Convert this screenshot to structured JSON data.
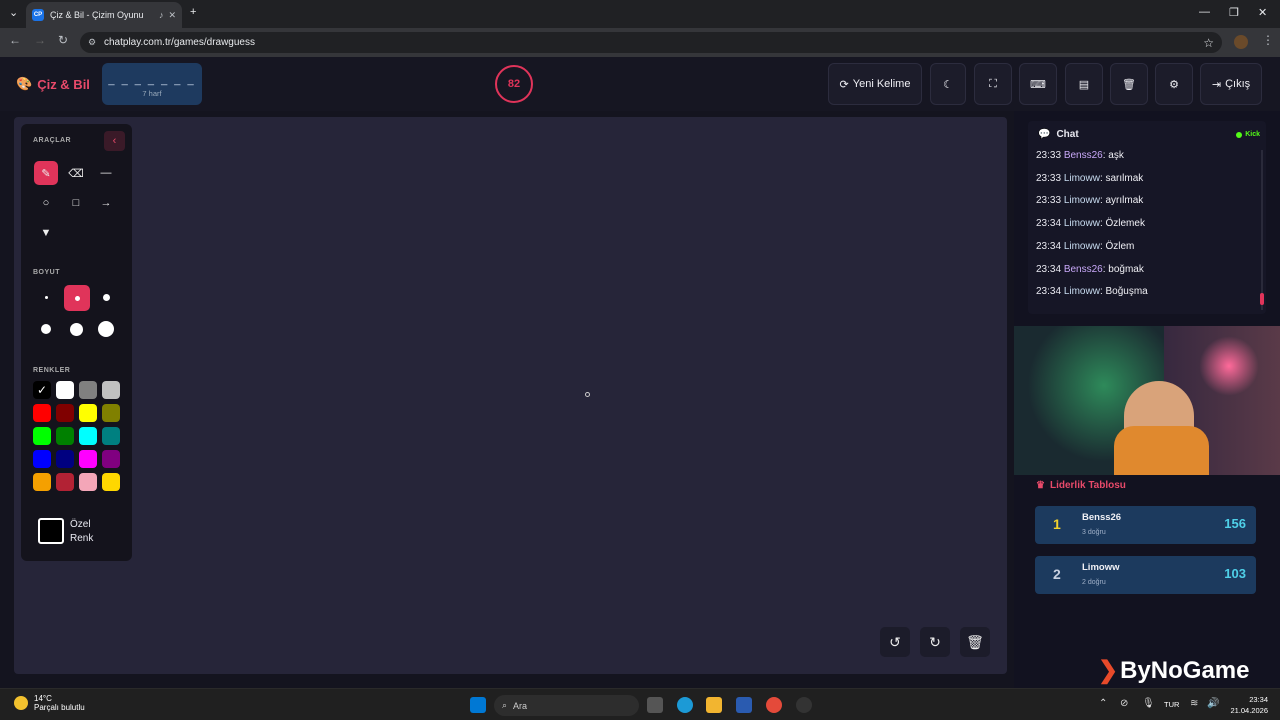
{
  "browser": {
    "tab_title": "Çiz & Bil - Çizim Oyunu",
    "tab_favicon": "CP",
    "url": "chatplay.com.tr/games/drawguess"
  },
  "header": {
    "logo_text": "Çiz & Bil",
    "word_dashes": "_ _ _ _ _ _ _",
    "word_hint": "7 harf",
    "timer": "82",
    "new_word_label": "Yeni Kelime",
    "exit_label": "Çıkış"
  },
  "tools": {
    "tools_title": "ARAÇLAR",
    "size_title": "BOYUT",
    "colors_title": "RENKLER",
    "custom_color_line1": "Özel",
    "custom_color_line2": "Renk",
    "colors": [
      "#000000",
      "#ffffff",
      "#808080",
      "#c0c0c0",
      "#ff0000",
      "#800000",
      "#ffff00",
      "#808000",
      "#00ff00",
      "#008000",
      "#00ffff",
      "#008080",
      "#0000ff",
      "#000080",
      "#ff00ff",
      "#800080",
      "#f5a000",
      "#b22234",
      "#f4a6b8",
      "#ffd700"
    ],
    "selected_color": "#000000"
  },
  "chat": {
    "title": "Chat",
    "platform": "Kick",
    "messages": [
      {
        "time": "23:33",
        "user": "Benss26",
        "text": "aşk"
      },
      {
        "time": "23:33",
        "user": "Limoww",
        "text": "sarılmak"
      },
      {
        "time": "23:33",
        "user": "Limoww",
        "text": "ayrılmak"
      },
      {
        "time": "23:34",
        "user": "Limoww",
        "text": "Özlemek"
      },
      {
        "time": "23:34",
        "user": "Limoww",
        "text": "Özlem"
      },
      {
        "time": "23:34",
        "user": "Benss26",
        "text": "boğmak"
      },
      {
        "time": "23:34",
        "user": "Limoww",
        "text": "Boğuşma"
      }
    ]
  },
  "leaderboard": {
    "title": "Liderlik Tablosu",
    "rows": [
      {
        "rank": "1",
        "name": "Benss26",
        "sub": "3 doğru",
        "score": "156"
      },
      {
        "rank": "2",
        "name": "Limoww",
        "sub": "2 doğru",
        "score": "103"
      }
    ]
  },
  "watermark": "ByNoGame",
  "taskbar": {
    "temp": "14°C",
    "weather": "Parçalı bulutlu",
    "search": "Ara",
    "lang": "TUR",
    "time": "23:34",
    "date": "21.04.2026"
  },
  "colors": {
    "accent": "#e0345a",
    "canvas": "#262539",
    "leader_row": "#1c3a5e",
    "score": "#4fd0e8",
    "kick_green": "#53fc18"
  }
}
